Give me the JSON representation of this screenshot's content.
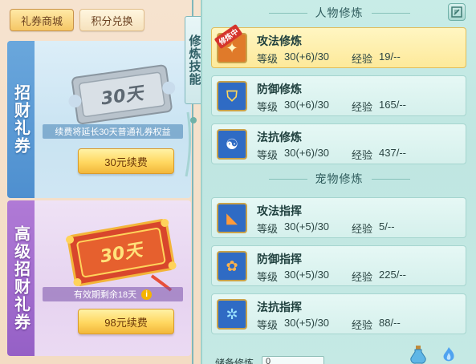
{
  "shop_tabs": [
    {
      "label": "礼券商城",
      "active": true
    },
    {
      "label": "积分兑换",
      "active": false
    }
  ],
  "cards": [
    {
      "side_label": "招财礼券",
      "ticket_text": "30天",
      "note": "续费将延长30天普通礼券权益",
      "button": "30元续费"
    },
    {
      "side_label": "高级招财礼券",
      "ticket_text": "30天",
      "note": "有效期剩余18天",
      "button": "98元续费"
    }
  ],
  "ribbon_label": "修炼技能",
  "sections": {
    "character_title": "人物修炼",
    "pet_title": "宠物修炼"
  },
  "practicing_badge": "修炼中",
  "character_skills": [
    {
      "name": "攻法修炼",
      "level_label": "等级",
      "level": "30(+6)/30",
      "exp_label": "经验",
      "exp": "19/--",
      "selected": true
    },
    {
      "name": "防御修炼",
      "level_label": "等级",
      "level": "30(+6)/30",
      "exp_label": "经验",
      "exp": "165/--",
      "selected": false
    },
    {
      "name": "法抗修炼",
      "level_label": "等级",
      "level": "30(+6)/30",
      "exp_label": "经验",
      "exp": "437/--",
      "selected": false
    }
  ],
  "pet_skills": [
    {
      "name": "攻法指挥",
      "level_label": "等级",
      "level": "30(+5)/30",
      "exp_label": "经验",
      "exp": "5/--"
    },
    {
      "name": "防御指挥",
      "level_label": "等级",
      "level": "30(+5)/30",
      "exp_label": "经验",
      "exp": "225/--"
    },
    {
      "name": "法抗指挥",
      "level_label": "等级",
      "level": "30(+5)/30",
      "exp_label": "经验",
      "exp": "88/--"
    }
  ],
  "bottom": {
    "label": "储备修炼",
    "value": "0"
  },
  "icons": {
    "edit": "edit-icon",
    "potion": "potion-icon",
    "flame": "flame-icon"
  },
  "colors": {
    "accent_gold": "#ffd760",
    "panel_teal": "#c8ece7",
    "basic_blue": "#4e8fcf",
    "premium_purple": "#9560c6"
  }
}
